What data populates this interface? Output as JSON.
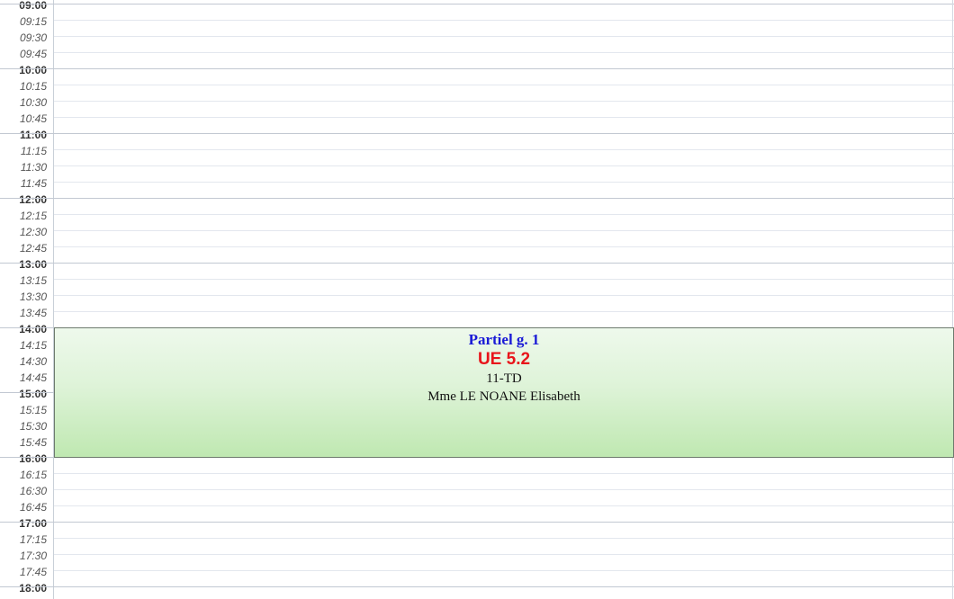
{
  "timeline": {
    "labels": [
      {
        "text": "09:00",
        "hour": true
      },
      {
        "text": "09:15",
        "hour": false
      },
      {
        "text": "09:30",
        "hour": false
      },
      {
        "text": "09:45",
        "hour": false
      },
      {
        "text": "10:00",
        "hour": true
      },
      {
        "text": "10:15",
        "hour": false
      },
      {
        "text": "10:30",
        "hour": false
      },
      {
        "text": "10:45",
        "hour": false
      },
      {
        "text": "11:00",
        "hour": true
      },
      {
        "text": "11:15",
        "hour": false
      },
      {
        "text": "11:30",
        "hour": false
      },
      {
        "text": "11:45",
        "hour": false
      },
      {
        "text": "12:00",
        "hour": true
      },
      {
        "text": "12:15",
        "hour": false
      },
      {
        "text": "12:30",
        "hour": false
      },
      {
        "text": "12:45",
        "hour": false
      },
      {
        "text": "13:00",
        "hour": true
      },
      {
        "text": "13:15",
        "hour": false
      },
      {
        "text": "13:30",
        "hour": false
      },
      {
        "text": "13:45",
        "hour": false
      },
      {
        "text": "14:00",
        "hour": true
      },
      {
        "text": "14:15",
        "hour": false
      },
      {
        "text": "14:30",
        "hour": false
      },
      {
        "text": "14:45",
        "hour": false
      },
      {
        "text": "15:00",
        "hour": true
      },
      {
        "text": "15:15",
        "hour": false
      },
      {
        "text": "15:30",
        "hour": false
      },
      {
        "text": "15:45",
        "hour": false
      },
      {
        "text": "16:00",
        "hour": true
      },
      {
        "text": "16:15",
        "hour": false
      },
      {
        "text": "16:30",
        "hour": false
      },
      {
        "text": "16:45",
        "hour": false
      },
      {
        "text": "17:00",
        "hour": true
      },
      {
        "text": "17:15",
        "hour": false
      },
      {
        "text": "17:30",
        "hour": false
      },
      {
        "text": "17:45",
        "hour": false
      },
      {
        "text": "18:00",
        "hour": true
      }
    ]
  },
  "event": {
    "title": "Partiel g. 1",
    "course": "UE 5.2",
    "room": "11-TD",
    "teacher": "Mme LE NOANE Elisabeth",
    "start": "14:00",
    "end": "16:00",
    "colors": {
      "title": "#1a1ad6",
      "course": "#e8141a",
      "background": "#d6f0cf",
      "border": "#6d7a6d"
    }
  }
}
